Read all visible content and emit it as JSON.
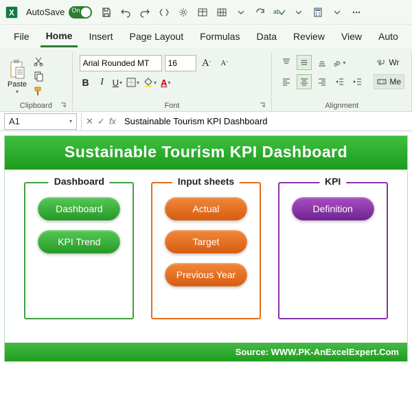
{
  "title_bar": {
    "autosave_label": "AutoSave",
    "autosave_on": "On"
  },
  "tabs": {
    "file": "File",
    "home": "Home",
    "insert": "Insert",
    "page_layout": "Page Layout",
    "formulas": "Formulas",
    "data": "Data",
    "review": "Review",
    "view": "View",
    "automate": "Auto"
  },
  "ribbon": {
    "clipboard": {
      "paste": "Paste",
      "group": "Clipboard"
    },
    "font": {
      "group": "Font",
      "family": "Arial Rounded MT",
      "size": "16",
      "grow": "A",
      "shrink": "A",
      "bold": "B",
      "italic": "I",
      "underline": "U"
    },
    "alignment": {
      "group": "Alignment",
      "wrap": "Wr",
      "merge": "Me"
    }
  },
  "formula_bar": {
    "cell_ref": "A1",
    "fx": "fx",
    "formula": "Sustainable Tourism KPI Dashboard"
  },
  "dashboard": {
    "title": "Sustainable Tourism KPI Dashboard",
    "panels": {
      "dashboard": {
        "title": "Dashboard",
        "items": [
          "Dashboard",
          "KPI Trend"
        ]
      },
      "input": {
        "title": "Input sheets",
        "items": [
          "Actual",
          "Target",
          "Previous Year"
        ]
      },
      "kpi": {
        "title": "KPI",
        "items": [
          "Definition"
        ]
      }
    },
    "source": "Source: WWW.PK-AnExcelExpert.Com"
  }
}
